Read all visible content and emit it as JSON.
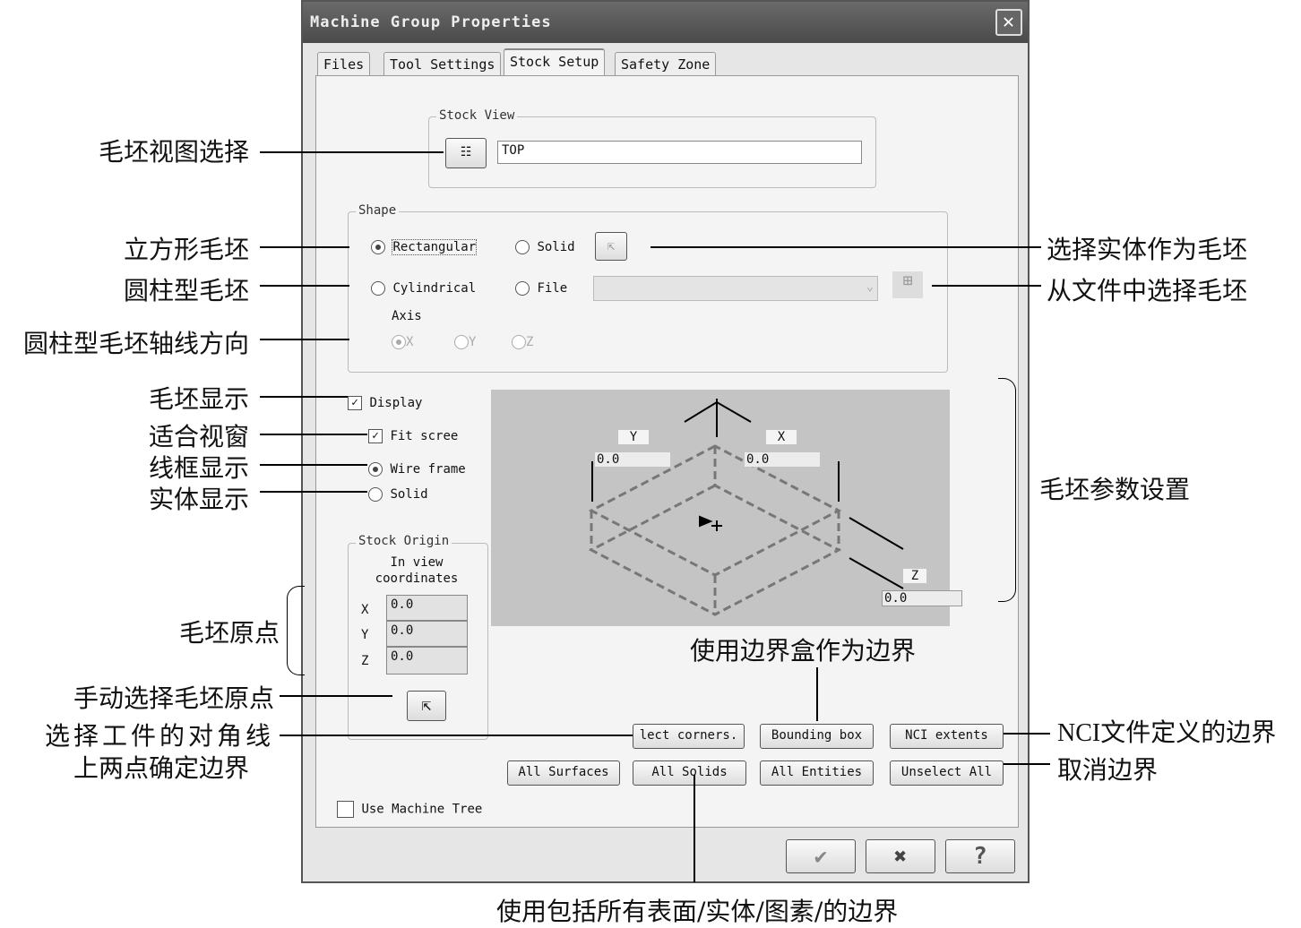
{
  "dialog": {
    "title": "Machine Group Properties",
    "close_icon": "close-icon"
  },
  "tabs": [
    {
      "label": "Files"
    },
    {
      "label": "Tool Settings"
    },
    {
      "label": "Stock Setup",
      "selected": true
    },
    {
      "label": "Safety Zone"
    }
  ],
  "stock_view": {
    "group_label": "Stock View",
    "value": "TOP"
  },
  "shape": {
    "group_label": "Shape",
    "rectangular": "Rectangular",
    "solid": "Solid",
    "cylindrical": "Cylindrical",
    "file": "File",
    "file_value": "",
    "axis_label": "Axis",
    "axes": [
      "X",
      "Y",
      "Z"
    ],
    "selected": "Rectangular",
    "selected_axis": "X"
  },
  "display": {
    "display_label": "Display",
    "display_checked": true,
    "fit_label": "Fit scree",
    "fit_checked": true,
    "wireframe_label": "Wire frame",
    "solid_label": "Solid",
    "selected": "Wire frame"
  },
  "stock_origin": {
    "group_label": "Stock Origin",
    "subtitle": "In view coordinates",
    "x_label": "X",
    "y_label": "Y",
    "z_label": "Z",
    "x": "0.0",
    "y": "0.0",
    "z": "0.0"
  },
  "preview": {
    "y_label": "Y",
    "y_value": "0.0",
    "x_label": "X",
    "x_value": "0.0",
    "z_label": "Z",
    "z_value": "0.0"
  },
  "buttons": {
    "select_corners": "lect corners.",
    "bounding_box": "Bounding box",
    "nci_extents": "NCI extents",
    "all_surfaces": "All Surfaces",
    "all_solids": "All Solids",
    "all_entities": "All Entities",
    "unselect_all": "Unselect All"
  },
  "use_machine_tree": {
    "label": "Use Machine Tree",
    "checked": false
  },
  "footer": {
    "ok_icon": "check-icon",
    "cancel_icon": "x-icon",
    "help_icon": "help-icon"
  },
  "annotations": {
    "stock_view": "毛坯视图选择",
    "rectangular": "立方形毛坯",
    "cylindrical": "圆柱型毛坯",
    "axis": "圆柱型毛坯轴线方向",
    "display": "毛坯显示",
    "fit": "适合视窗",
    "wireframe": "线框显示",
    "solid": "实体显示",
    "origin": "毛坯原点",
    "manual_origin": "手动选择毛坯原点",
    "corners_1": "选择工件的对角线",
    "corners_2": "上两点确定边界",
    "select_solid": "选择实体作为毛坯",
    "from_file": "从文件中选择毛坯",
    "params": "毛坯参数设置",
    "bounding": "使用边界盒作为边界",
    "nci": "NCI文件定义的边界",
    "unselect": "取消边界",
    "all": "使用包括所有表面/实体/图素/的边界"
  }
}
